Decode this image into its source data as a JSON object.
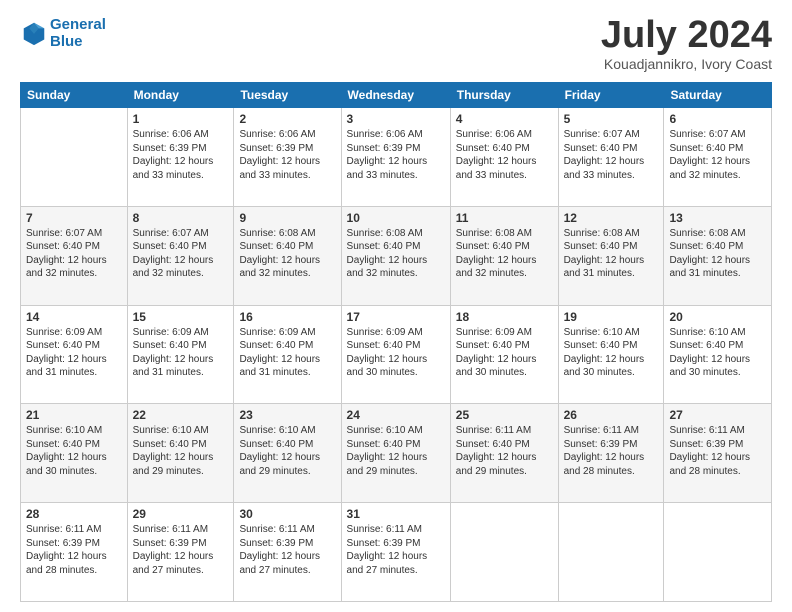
{
  "logo": {
    "line1": "General",
    "line2": "Blue"
  },
  "title": "July 2024",
  "location": "Kouadjannikro, Ivory Coast",
  "weekdays": [
    "Sunday",
    "Monday",
    "Tuesday",
    "Wednesday",
    "Thursday",
    "Friday",
    "Saturday"
  ],
  "weeks": [
    [
      {
        "day": "",
        "info": ""
      },
      {
        "day": "1",
        "info": "Sunrise: 6:06 AM\nSunset: 6:39 PM\nDaylight: 12 hours\nand 33 minutes."
      },
      {
        "day": "2",
        "info": "Sunrise: 6:06 AM\nSunset: 6:39 PM\nDaylight: 12 hours\nand 33 minutes."
      },
      {
        "day": "3",
        "info": "Sunrise: 6:06 AM\nSunset: 6:39 PM\nDaylight: 12 hours\nand 33 minutes."
      },
      {
        "day": "4",
        "info": "Sunrise: 6:06 AM\nSunset: 6:40 PM\nDaylight: 12 hours\nand 33 minutes."
      },
      {
        "day": "5",
        "info": "Sunrise: 6:07 AM\nSunset: 6:40 PM\nDaylight: 12 hours\nand 33 minutes."
      },
      {
        "day": "6",
        "info": "Sunrise: 6:07 AM\nSunset: 6:40 PM\nDaylight: 12 hours\nand 32 minutes."
      }
    ],
    [
      {
        "day": "7",
        "info": "Sunrise: 6:07 AM\nSunset: 6:40 PM\nDaylight: 12 hours\nand 32 minutes."
      },
      {
        "day": "8",
        "info": "Sunrise: 6:07 AM\nSunset: 6:40 PM\nDaylight: 12 hours\nand 32 minutes."
      },
      {
        "day": "9",
        "info": "Sunrise: 6:08 AM\nSunset: 6:40 PM\nDaylight: 12 hours\nand 32 minutes."
      },
      {
        "day": "10",
        "info": "Sunrise: 6:08 AM\nSunset: 6:40 PM\nDaylight: 12 hours\nand 32 minutes."
      },
      {
        "day": "11",
        "info": "Sunrise: 6:08 AM\nSunset: 6:40 PM\nDaylight: 12 hours\nand 32 minutes."
      },
      {
        "day": "12",
        "info": "Sunrise: 6:08 AM\nSunset: 6:40 PM\nDaylight: 12 hours\nand 31 minutes."
      },
      {
        "day": "13",
        "info": "Sunrise: 6:08 AM\nSunset: 6:40 PM\nDaylight: 12 hours\nand 31 minutes."
      }
    ],
    [
      {
        "day": "14",
        "info": "Sunrise: 6:09 AM\nSunset: 6:40 PM\nDaylight: 12 hours\nand 31 minutes."
      },
      {
        "day": "15",
        "info": "Sunrise: 6:09 AM\nSunset: 6:40 PM\nDaylight: 12 hours\nand 31 minutes."
      },
      {
        "day": "16",
        "info": "Sunrise: 6:09 AM\nSunset: 6:40 PM\nDaylight: 12 hours\nand 31 minutes."
      },
      {
        "day": "17",
        "info": "Sunrise: 6:09 AM\nSunset: 6:40 PM\nDaylight: 12 hours\nand 30 minutes."
      },
      {
        "day": "18",
        "info": "Sunrise: 6:09 AM\nSunset: 6:40 PM\nDaylight: 12 hours\nand 30 minutes."
      },
      {
        "day": "19",
        "info": "Sunrise: 6:10 AM\nSunset: 6:40 PM\nDaylight: 12 hours\nand 30 minutes."
      },
      {
        "day": "20",
        "info": "Sunrise: 6:10 AM\nSunset: 6:40 PM\nDaylight: 12 hours\nand 30 minutes."
      }
    ],
    [
      {
        "day": "21",
        "info": "Sunrise: 6:10 AM\nSunset: 6:40 PM\nDaylight: 12 hours\nand 30 minutes."
      },
      {
        "day": "22",
        "info": "Sunrise: 6:10 AM\nSunset: 6:40 PM\nDaylight: 12 hours\nand 29 minutes."
      },
      {
        "day": "23",
        "info": "Sunrise: 6:10 AM\nSunset: 6:40 PM\nDaylight: 12 hours\nand 29 minutes."
      },
      {
        "day": "24",
        "info": "Sunrise: 6:10 AM\nSunset: 6:40 PM\nDaylight: 12 hours\nand 29 minutes."
      },
      {
        "day": "25",
        "info": "Sunrise: 6:11 AM\nSunset: 6:40 PM\nDaylight: 12 hours\nand 29 minutes."
      },
      {
        "day": "26",
        "info": "Sunrise: 6:11 AM\nSunset: 6:39 PM\nDaylight: 12 hours\nand 28 minutes."
      },
      {
        "day": "27",
        "info": "Sunrise: 6:11 AM\nSunset: 6:39 PM\nDaylight: 12 hours\nand 28 minutes."
      }
    ],
    [
      {
        "day": "28",
        "info": "Sunrise: 6:11 AM\nSunset: 6:39 PM\nDaylight: 12 hours\nand 28 minutes."
      },
      {
        "day": "29",
        "info": "Sunrise: 6:11 AM\nSunset: 6:39 PM\nDaylight: 12 hours\nand 27 minutes."
      },
      {
        "day": "30",
        "info": "Sunrise: 6:11 AM\nSunset: 6:39 PM\nDaylight: 12 hours\nand 27 minutes."
      },
      {
        "day": "31",
        "info": "Sunrise: 6:11 AM\nSunset: 6:39 PM\nDaylight: 12 hours\nand 27 minutes."
      },
      {
        "day": "",
        "info": ""
      },
      {
        "day": "",
        "info": ""
      },
      {
        "day": "",
        "info": ""
      }
    ]
  ]
}
